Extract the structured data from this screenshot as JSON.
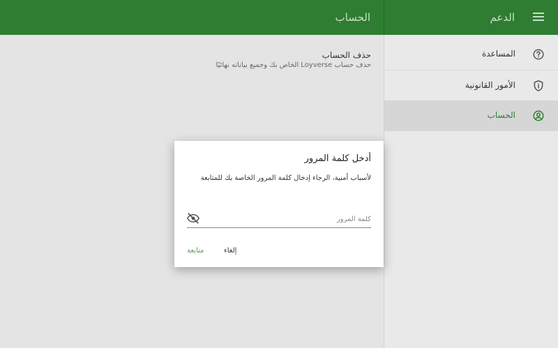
{
  "header": {
    "main_title": "الحساب",
    "sidebar_title": "الدعم",
    "menu_icon": "menu-icon"
  },
  "content": {
    "setting_title": "حذف الحساب",
    "setting_subtitle": "حذف حساب Loyverse الخاص بك وجميع بياناته نهائيًا"
  },
  "sidebar": {
    "items": [
      {
        "label": "المساعدة",
        "icon": "help-circle-icon",
        "active": false
      },
      {
        "label": "الأمور القانونية",
        "icon": "shield-info-icon",
        "active": false
      },
      {
        "label": "الحساب",
        "icon": "account-circle-icon",
        "active": true
      }
    ]
  },
  "dialog": {
    "title": "أدخل كلمة المرور",
    "message": "لأسباب أمنية، الرجاء إدخال كلمة المرور الخاصة بك للمتابعة",
    "password_placeholder": "كلمة المرور",
    "password_value": "",
    "visibility_icon": "eye-off-icon",
    "cancel_label": "إلغاء",
    "continue_label": "متابعة"
  },
  "colors": {
    "primary": "#2e7d32",
    "accent": "#5da154",
    "header_text": "#c9e0ca"
  }
}
